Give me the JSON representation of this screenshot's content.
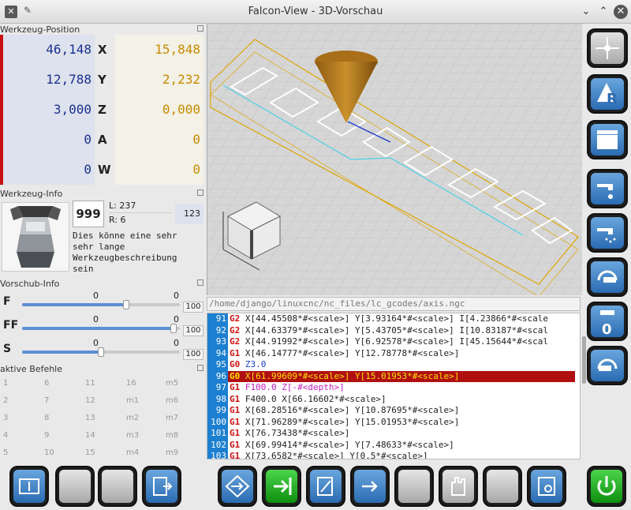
{
  "window": {
    "title": "Falcon-View - 3D-Vorschau"
  },
  "sections": {
    "position": "Werkzeug-Position",
    "tool": "Werkzeug-Info",
    "feed": "Vorschub-Info",
    "commands": "aktive Befehle"
  },
  "position": {
    "axes": [
      {
        "axis": "X",
        "abs": "46,148",
        "dtg": "15,848"
      },
      {
        "axis": "Y",
        "abs": "12,788",
        "dtg": "2,232"
      },
      {
        "axis": "Z",
        "abs": "3,000",
        "dtg": "0,000"
      },
      {
        "axis": "A",
        "abs": "0",
        "dtg": "0"
      },
      {
        "axis": "W",
        "abs": "0",
        "dtg": "0"
      }
    ]
  },
  "tool": {
    "number": "999",
    "length": "L: 237",
    "radius": "R: 6",
    "extra": "123",
    "description_lines": [
      "Dies könne eine sehr",
      "sehr lange",
      "Werkzeugbeschreibung",
      "sein"
    ]
  },
  "feed": {
    "rows": [
      {
        "label": "F",
        "v1": "0",
        "v2": "0",
        "pct": "100",
        "level": 0.66
      },
      {
        "label": "FF",
        "v1": "0",
        "v2": "0",
        "pct": "100",
        "level": 0.96
      },
      {
        "label": "S",
        "v1": "0",
        "v2": "0",
        "pct": "100",
        "level": 0.5
      }
    ]
  },
  "commands": {
    "columns": [
      [
        "1",
        "2",
        "3",
        "4",
        "5"
      ],
      [
        "6",
        "7",
        "8",
        "9",
        "10"
      ],
      [
        "11",
        "12",
        "13",
        "14",
        "15"
      ],
      [
        "16",
        "m1",
        "m2",
        "m3",
        "m4"
      ],
      [
        "m5",
        "m6",
        "m7",
        "m8",
        "m9"
      ]
    ]
  },
  "gcode": {
    "path": "/home/django/linuxcnc/nc_files/lc_gcodes/axis.ngc",
    "active_line": "96",
    "lines": [
      {
        "n": "91",
        "code": "G2",
        "rest": " X[44.45508*#<scale>] Y[3.93164*#<scale>] I[4.23866*#<scale"
      },
      {
        "n": "92",
        "code": "G2",
        "rest": " X[44.63379*#<scale>] Y[5.43705*#<scale>] I[10.83187*#<scal"
      },
      {
        "n": "93",
        "code": "G2",
        "rest": " X[44.91992*#<scale>] Y[6.92578*#<scale>] I[45.15644*#<scal"
      },
      {
        "n": "94",
        "code": "G1",
        "rest": " X[46.14777*#<scale>] Y[12.78778*#<scale>]"
      },
      {
        "n": "95",
        "code": "G0",
        "rest": " Z3.0"
      },
      {
        "n": "96",
        "code": "G0",
        "rest": " X[61.99609*#<scale>] Y[15.01953*#<scale>]"
      },
      {
        "n": "97",
        "code": "G1",
        "rest": " F100.0 Z[-#<depth>]"
      },
      {
        "n": "98",
        "code": "G1",
        "rest": " F400.0 X[66.16602*#<scale>]"
      },
      {
        "n": "99",
        "code": "G1",
        "rest": " X[68.28516*#<scale>] Y[10.87695*#<scale>]"
      },
      {
        "n": "100",
        "code": "G1",
        "rest": " X[71.96289*#<scale>] Y[15.01953*#<scale>]"
      },
      {
        "n": "101",
        "code": "G1",
        "rest": " X[76.73438*#<scale>]"
      },
      {
        "n": "102",
        "code": "G1",
        "rest": " X[69.99414*#<scale>] Y[7.48633*#<scale>]"
      },
      {
        "n": "103",
        "code": "G1",
        "rest": " X[73.6582*#<scale>] Y[0.5*#<scale>]"
      }
    ]
  },
  "colors": {
    "active_line": "#b01010",
    "line_number_bg": "#1c7fd0",
    "g_code_red": "#d01010",
    "abs_position": "#1b2f8f",
    "dtg": "#c78a00"
  },
  "right_buttons": [
    {
      "name": "jog-center-button",
      "style": "grey"
    },
    {
      "name": "auto-reference-button",
      "style": "blue"
    },
    {
      "name": "clapperboard-button",
      "style": "blue"
    },
    {
      "name": "coolant-flood-button",
      "style": "blue"
    },
    {
      "name": "coolant-mist-button",
      "style": "blue"
    },
    {
      "name": "spindle-button",
      "style": "blue"
    },
    {
      "name": "spindle-zero-button",
      "style": "blue",
      "label": "0"
    },
    {
      "name": "spindle-reverse-button",
      "style": "blue"
    }
  ],
  "bottom_buttons": [
    {
      "name": "panel-toggle-button",
      "style": "blue"
    },
    {
      "name": "blank-button-1",
      "style": "grey"
    },
    {
      "name": "blank-button-2",
      "style": "grey"
    },
    {
      "name": "open-file-button",
      "style": "blue"
    },
    {
      "name": "step-button",
      "style": "blue"
    },
    {
      "name": "run-button",
      "style": "green"
    },
    {
      "name": "edit-button",
      "style": "blue"
    },
    {
      "name": "next-button",
      "style": "blue"
    },
    {
      "name": "blank-button-3",
      "style": "grey"
    },
    {
      "name": "hand-button",
      "style": "grey"
    },
    {
      "name": "blank-button-4",
      "style": "grey"
    },
    {
      "name": "settings-button",
      "style": "blue"
    },
    {
      "name": "power-button",
      "style": "green"
    }
  ]
}
